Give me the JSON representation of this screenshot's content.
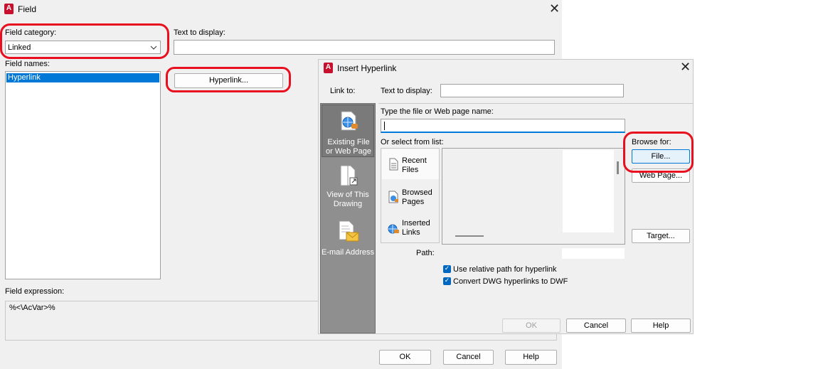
{
  "field_dialog": {
    "title": "Field",
    "close_glyph": "✕",
    "field_category_label": "Field category:",
    "field_category_value": "Linked",
    "text_to_display_label": "Text to display:",
    "text_to_display_value": "",
    "field_names_label": "Field names:",
    "field_names": [
      "Hyperlink"
    ],
    "hyperlink_button": "Hyperlink...",
    "field_expression_label": "Field expression:",
    "field_expression_value": "%<\\AcVar>%",
    "ok": "OK",
    "cancel": "Cancel",
    "help": "Help"
  },
  "hyperlink_dialog": {
    "title": "Insert Hyperlink",
    "close_glyph": "✕",
    "link_to_label": "Link to:",
    "text_to_display_label": "Text to display:",
    "text_to_display_value": "",
    "file_name_label": "Type the file or Web page name:",
    "file_name_value": "",
    "select_from_list_label": "Or select from list:",
    "sidebar": [
      {
        "label": "Existing File or Web Page",
        "icon": "web-page-icon"
      },
      {
        "label": "View of This Drawing",
        "icon": "drawing-view-icon"
      },
      {
        "label": "E-mail Address",
        "icon": "email-icon"
      }
    ],
    "list_tabs": [
      {
        "label": "Recent Files",
        "icon": "recent-files-icon"
      },
      {
        "label": "Browsed Pages",
        "icon": "browsed-pages-icon"
      },
      {
        "label": "Inserted Links",
        "icon": "inserted-links-icon"
      }
    ],
    "path_label": "Path:",
    "path_value": "",
    "browse_for_label": "Browse for:",
    "file_button": "File...",
    "web_page_button": "Web Page...",
    "target_button": "Target...",
    "relative_path_label": "Use relative path for hyperlink",
    "relative_path_checked": true,
    "convert_dwg_label": "Convert DWG hyperlinks to DWF",
    "convert_dwg_checked": true,
    "ok": "OK",
    "cancel": "Cancel",
    "help": "Help"
  },
  "colors": {
    "selection": "#0078d7",
    "annotation_red": "#e8101e",
    "sidebar_gray": "#8f8f8f",
    "app_icon_red": "#c8102e"
  }
}
